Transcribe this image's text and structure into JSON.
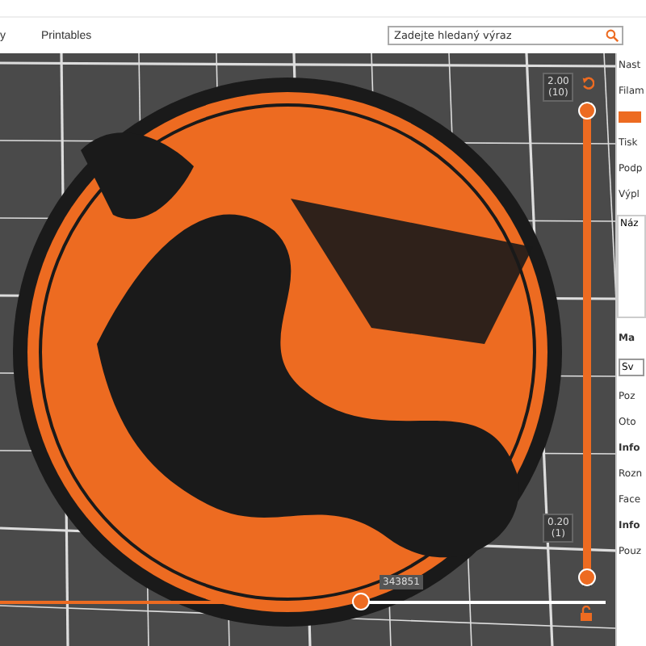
{
  "tabs": [
    {
      "label": "y",
      "selected": false
    },
    {
      "label": "Printables",
      "selected": false
    }
  ],
  "search": {
    "placeholder": "Zadejte hledaný výraz"
  },
  "layer_slider": {
    "top_label": "2.00",
    "top_sub": "(10)",
    "bottom_label": "0.20",
    "bottom_sub": "(1)",
    "upper": {
      "level": 1
    },
    "lower": {
      "level": 0
    }
  },
  "move_slider": {
    "level": 0.6,
    "reading": "343851"
  },
  "sidebar": {
    "labels": [
      {
        "text": "Nast",
        "kind": "label"
      },
      {
        "text": "Filam",
        "kind": "label"
      },
      {
        "kind": "swatch"
      },
      {
        "text": "Tisk",
        "kind": "label"
      },
      {
        "text": "Podp",
        "kind": "label"
      },
      {
        "text": "Výpl",
        "kind": "label"
      },
      {
        "text": "Náz",
        "kind": "list"
      },
      {
        "text": "Ma",
        "kind": "heading"
      },
      {
        "text": "Sv",
        "kind": "combo"
      },
      {
        "text": "Poz",
        "kind": "label"
      },
      {
        "text": "Oto",
        "kind": "label"
      },
      {
        "text": "Info",
        "kind": "heading"
      },
      {
        "text": "Rozn",
        "kind": "label"
      },
      {
        "text": "Face",
        "kind": "label"
      },
      {
        "text": "Info",
        "kind": "heading"
      },
      {
        "text": "Pouz",
        "kind": "label"
      }
    ]
  }
}
